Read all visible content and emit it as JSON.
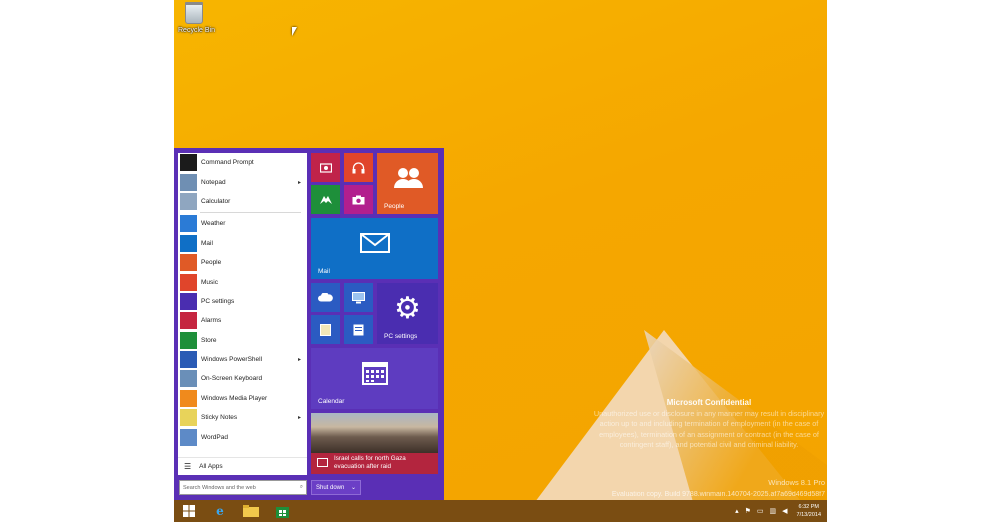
{
  "desktop": {
    "recycle_bin_label": "Recycle Bin",
    "background_color": "#f5a700"
  },
  "start_menu": {
    "accent_color": "#5a2fb5",
    "apps": [
      {
        "label": "Command Prompt",
        "icon": "command-prompt-icon",
        "color": "#1b1b1b",
        "arrow": false
      },
      {
        "label": "Notepad",
        "icon": "notepad-icon",
        "color": "#6f8fb3",
        "arrow": true
      },
      {
        "label": "Calculator",
        "icon": "calculator-icon",
        "color": "#8fa6c0",
        "arrow": false
      },
      {
        "label": "Weather",
        "icon": "weather-icon",
        "color": "#2b7bd6",
        "arrow": false
      },
      {
        "label": "Mail",
        "icon": "mail-icon",
        "color": "#0f6fc6",
        "arrow": false
      },
      {
        "label": "People",
        "icon": "people-icon",
        "color": "#e05a26",
        "arrow": false
      },
      {
        "label": "Music",
        "icon": "music-icon",
        "color": "#e0452b",
        "arrow": false
      },
      {
        "label": "PC settings",
        "icon": "gear-icon",
        "color": "#4a2db0",
        "arrow": false
      },
      {
        "label": "Alarms",
        "icon": "alarm-icon",
        "color": "#c52540",
        "arrow": false
      },
      {
        "label": "Store",
        "icon": "store-icon",
        "color": "#1e8f3a",
        "arrow": false
      },
      {
        "label": "Windows PowerShell",
        "icon": "powershell-icon",
        "color": "#2a5bb5",
        "arrow": true
      },
      {
        "label": "On-Screen Keyboard",
        "icon": "keyboard-icon",
        "color": "#6a8fb8",
        "arrow": false
      },
      {
        "label": "Windows Media Player",
        "icon": "media-player-icon",
        "color": "#f08a1c",
        "arrow": false
      },
      {
        "label": "Sticky Notes",
        "icon": "sticky-notes-icon",
        "color": "#e8d35a",
        "arrow": true
      },
      {
        "label": "WordPad",
        "icon": "wordpad-icon",
        "color": "#5d8ac7",
        "arrow": false
      }
    ],
    "all_apps_label": "All Apps",
    "search_placeholder": "Search Windows and the web",
    "shutdown_label": "Shut down",
    "tiles": {
      "people": "People",
      "mail": "Mail",
      "pc_settings": "PC settings",
      "calendar": "Calendar",
      "news_headline": "Israel calls for north Gaza evacuation after raid"
    }
  },
  "watermark": {
    "title": "Microsoft Confidential",
    "body": "Unauthorized use or disclosure in any manner may result in disciplinary action up to and including termination of employment (in the case of employees), termination of an assignment or contract (in the case of contingent staff), and potential civil and criminal liability.",
    "edition": "Windows 8.1 Pro",
    "build": "Evaluation copy. Build 9788.winmain.140704-2025.af7a69d469d58f7"
  },
  "taskbar": {
    "time": "6:32 PM",
    "date": "7/13/2014",
    "color": "#7a4d12"
  }
}
